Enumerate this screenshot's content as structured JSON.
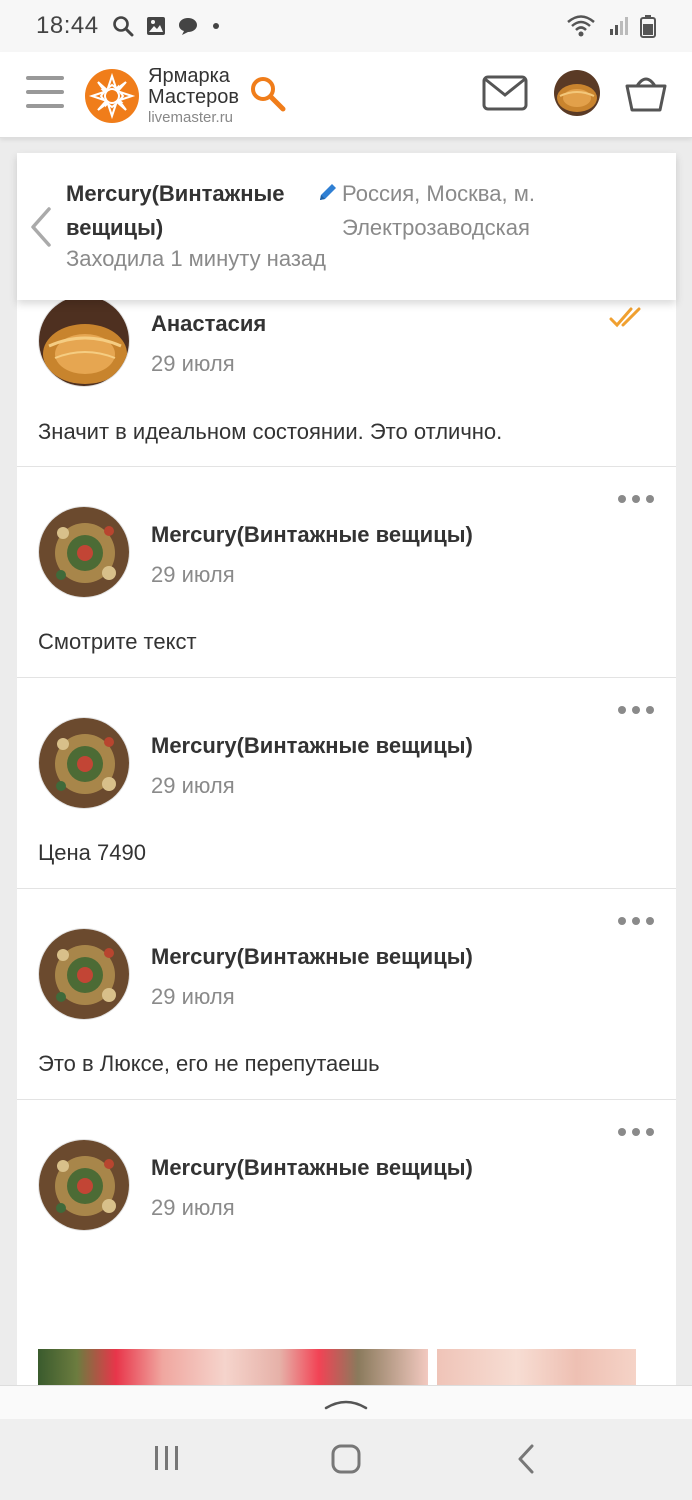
{
  "status_bar": {
    "time": "18:44",
    "icons": [
      "search-icon",
      "image-icon",
      "chat-bubble-icon",
      "dot-icon",
      "wifi-icon",
      "signal-icon",
      "battery-icon"
    ]
  },
  "header": {
    "logo_line1": "Ярмарка",
    "logo_line2": "Мастеров",
    "logo_domain": "livemaster.ru",
    "brand_color": "#f07d1a",
    "icons": [
      "menu-icon",
      "search-icon",
      "mail-icon",
      "avatar",
      "basket-icon"
    ]
  },
  "conversation": {
    "name": "Mercury(Винтажные вещицы)",
    "last_seen": "Заходила 1 минуту назад",
    "location": "Россия, Москва, м. Электрозаводская"
  },
  "messages": [
    {
      "author": "Анастасия",
      "date": "29 июля",
      "text": "Значит в идеальном состоянии. Это отлично.",
      "read": true
    },
    {
      "author": "Mercury(Винтажные вещицы)",
      "date": "29 июля",
      "text": "Смотрите текст"
    },
    {
      "author": "Mercury(Винтажные вещицы)",
      "date": "29 июля",
      "text": "Цена 7490"
    },
    {
      "author": "Mercury(Винтажные вещицы)",
      "date": "29 июля",
      "text": "Это в Люксе, его не перепутаешь"
    },
    {
      "author": "Mercury(Винтажные вещицы)",
      "date": "29 июля",
      "text": ""
    }
  ],
  "system_nav": {
    "icons": [
      "recent-apps-icon",
      "home-icon",
      "back-icon"
    ]
  }
}
